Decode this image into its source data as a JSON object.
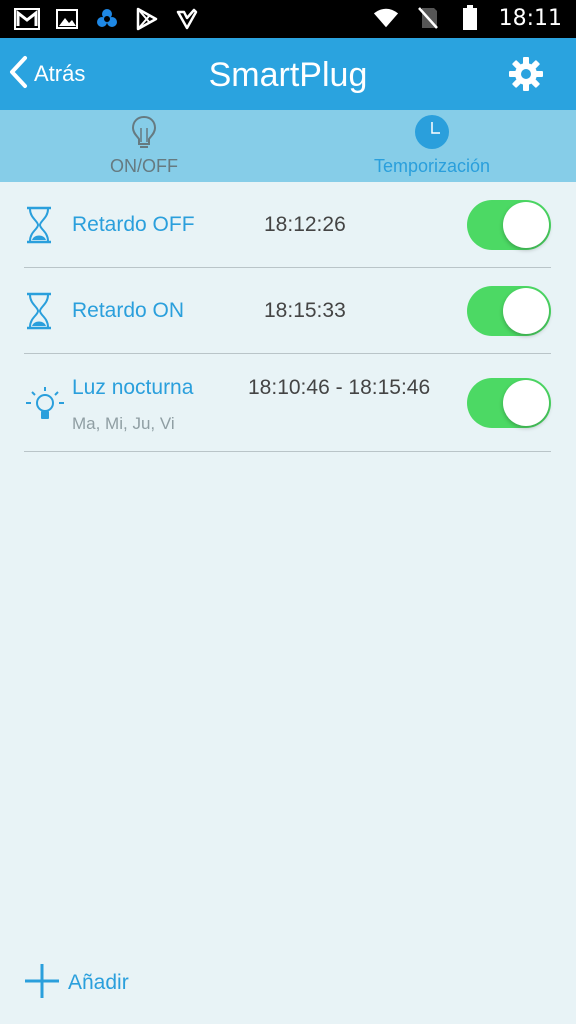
{
  "status_bar": {
    "time": "18:11",
    "left_icons": [
      "gmail-icon",
      "gallery-icon",
      "app-icon",
      "play-store-icon",
      "check-icon"
    ],
    "right_icons": [
      "wifi-icon",
      "no-signal-icon",
      "battery-icon"
    ]
  },
  "app_bar": {
    "back_label": "Atrás",
    "title": "SmartPlug",
    "settings_icon": "gear-icon"
  },
  "tabs": [
    {
      "label": "ON/OFF",
      "icon": "bulb-icon",
      "active": false
    },
    {
      "label": "Temporización",
      "icon": "clock-icon",
      "active": true
    }
  ],
  "schedules": [
    {
      "name": "Retardo OFF",
      "time": "18:12:26",
      "icon": "hourglass-icon",
      "enabled": true
    },
    {
      "name": "Retardo ON",
      "time": "18:15:33",
      "icon": "hourglass-icon",
      "enabled": true
    },
    {
      "name": "Luz nocturna",
      "time": "18:10:46 - 18:15:46",
      "days": "Ma, Mi, Ju, Vi",
      "icon": "night-light-icon",
      "enabled": true
    }
  ],
  "add": {
    "label": "Añadir",
    "icon": "plus-icon"
  },
  "colors": {
    "primary": "#2aa3df",
    "tab_bar": "#86cde8",
    "background": "#e8f3f6",
    "toggle_on": "#4cd964",
    "accent_text": "#2a9fdc"
  }
}
